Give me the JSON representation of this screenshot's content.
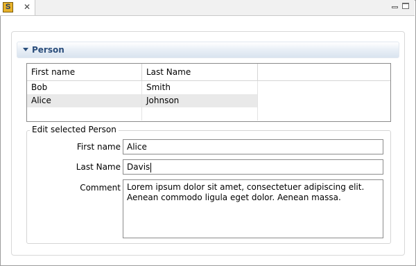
{
  "tab": {
    "app_icon_letter": "S",
    "close_glyph": "✕"
  },
  "section": {
    "title": "Person"
  },
  "table": {
    "columns": [
      "First name",
      "Last Name",
      ""
    ],
    "rows": [
      {
        "first": "Bob",
        "last": "Smith"
      },
      {
        "first": "Alice",
        "last": "Johnson"
      }
    ],
    "selected_row_index": 1
  },
  "form": {
    "legend": "Edit selected Person",
    "first_name_label": "First name",
    "first_name_value": "Alice",
    "last_name_label": "Last Name",
    "last_name_value": "Davis",
    "comment_label": "Comment",
    "comment_value": "Lorem ipsum dolor sit amet, consectetuer adipiscing elit.\nAenean commodo ligula eget dolor. Aenean massa."
  }
}
